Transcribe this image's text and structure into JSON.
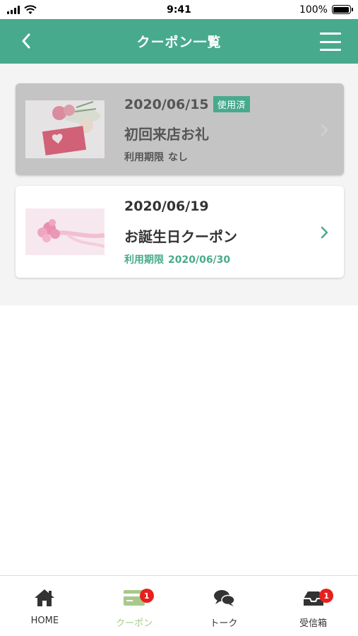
{
  "status_bar": {
    "time": "9:41",
    "battery": "100%"
  },
  "header": {
    "title": "クーポン一覧"
  },
  "coupons": [
    {
      "date": "2020/06/15",
      "badge": "使用済",
      "title": "初回来店お礼",
      "limit_label": "利用期限",
      "limit_value": "なし",
      "state": "used"
    },
    {
      "date": "2020/06/19",
      "badge": "",
      "title": "お誕生日クーポン",
      "limit_label": "利用期限",
      "limit_value": "2020/06/30",
      "state": "active"
    }
  ],
  "tabbar": {
    "tabs": [
      {
        "label": "HOME",
        "icon": "home-icon"
      },
      {
        "label": "クーポン",
        "icon": "coupon-card-icon",
        "badge": "1",
        "active": true
      },
      {
        "label": "トーク",
        "icon": "chat-bubbles-icon"
      },
      {
        "label": "受信箱",
        "icon": "inbox-icon",
        "badge": "1"
      }
    ]
  },
  "colors": {
    "accent": "#48aa8c",
    "tab_active": "#a8c98a",
    "badge_red": "#e6201d",
    "used_card": "#c4c4c4"
  }
}
